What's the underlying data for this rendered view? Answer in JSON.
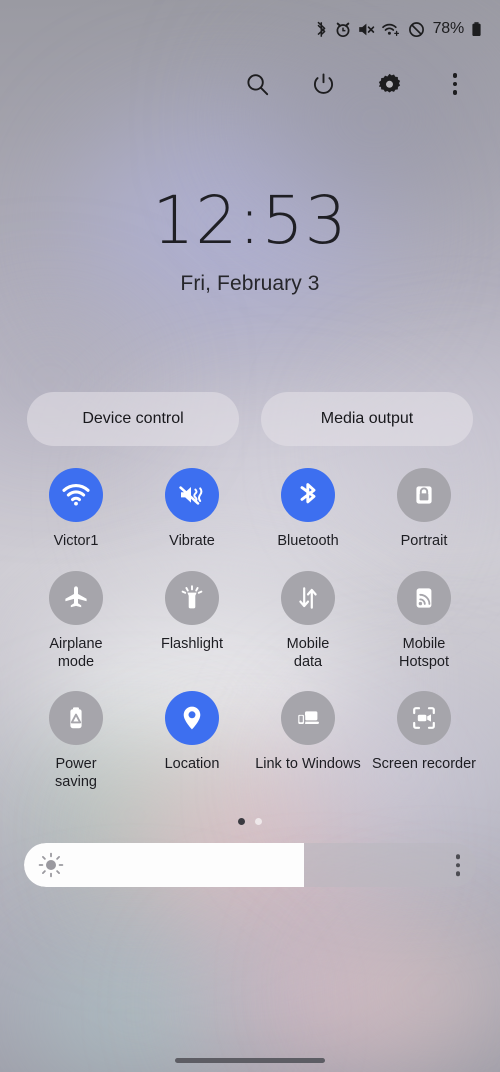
{
  "status_bar": {
    "icons": [
      "bluetooth-icon",
      "alarm-icon",
      "mute-icon",
      "wifi-icon",
      "do-not-disturb-icon"
    ],
    "battery_percent": "78%",
    "battery_icon": "battery-icon"
  },
  "toolbar": {
    "buttons": [
      {
        "name": "search-icon",
        "label": "Search"
      },
      {
        "name": "power-icon",
        "label": "Power off"
      },
      {
        "name": "gear-icon",
        "label": "Settings"
      },
      {
        "name": "more-options-icon",
        "label": "More options"
      }
    ]
  },
  "clock": {
    "time": "12:53",
    "date": "Fri, February 3"
  },
  "pills": [
    {
      "label": "Device control"
    },
    {
      "label": "Media output"
    }
  ],
  "quick_settings": {
    "tiles": [
      {
        "label": "Victor1",
        "icon": "wifi-icon",
        "state": "on"
      },
      {
        "label": "Vibrate",
        "icon": "vibrate-icon",
        "state": "on"
      },
      {
        "label": "Bluetooth",
        "icon": "bluetooth-icon",
        "state": "on"
      },
      {
        "label": "Portrait",
        "icon": "rotation-lock-icon",
        "state": "off"
      },
      {
        "label": "Airplane\nmode",
        "icon": "airplane-icon",
        "state": "off"
      },
      {
        "label": "Flashlight",
        "icon": "flashlight-icon",
        "state": "off"
      },
      {
        "label": "Mobile\ndata",
        "icon": "mobile-data-icon",
        "state": "off"
      },
      {
        "label": "Mobile\nHotspot",
        "icon": "hotspot-icon",
        "state": "off"
      },
      {
        "label": "Power\nsaving",
        "icon": "power-saving-icon",
        "state": "off"
      },
      {
        "label": "Location",
        "icon": "location-pin-icon",
        "state": "on"
      },
      {
        "label": "Link to Windows",
        "icon": "link-to-windows-icon",
        "state": "off"
      },
      {
        "label": "Screen recorder",
        "icon": "screen-recorder-icon",
        "state": "off"
      }
    ]
  },
  "page_indicator": {
    "total": 2,
    "active": 1
  },
  "brightness": {
    "value_percent": 62,
    "icon": "brightness-sun-icon",
    "menu_icon": "more-options-icon"
  },
  "colors": {
    "accent_on": "#3d6ff0",
    "tile_off": "#a6a5ab",
    "text": "#1d1d22",
    "slider_fill": "#fdfdfd"
  },
  "navigation": {
    "home_gesture_bar": "home-gesture-bar"
  }
}
